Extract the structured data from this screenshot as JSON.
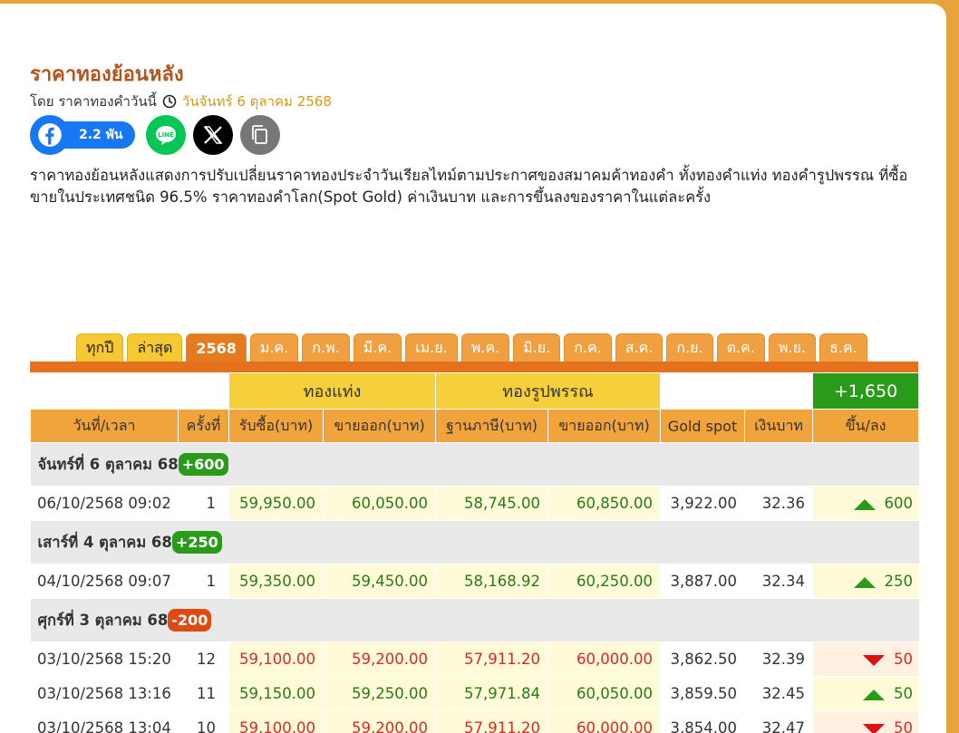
{
  "page": {
    "title": "ราคาทองย้อนหลัง",
    "byline_prefix": "โดย ราคาทองคำวันนี้",
    "date": "วันจันทร์ 6 ตุลาคม 2568",
    "description": "ราคาทองย้อนหลังแสดงการปรับเปลี่ยนราคาทองประจำวันเรียลไทม์ตามประกาศของสมาคมค้าทองคำ ทั้งทองคำแท่ง ทองคำรูปพรรณ ที่ซื้อขายในประเทศชนิด 96.5% ราคาทองคำโลก(Spot Gold) ค่าเงินบาท และการขึ้นลงของราคาในแต่ละครั้ง"
  },
  "share": {
    "facebook_count": "2.2 พัน",
    "colors": {
      "facebook": "#1877f2",
      "line": "#06c755",
      "x": "#000000",
      "copy": "#777777"
    }
  },
  "tabs": [
    {
      "label": "ทุกปี",
      "style": "yellow"
    },
    {
      "label": "ล่าสุด",
      "style": "yellow"
    },
    {
      "label": "2568",
      "style": "active"
    },
    {
      "label": "ม.ค."
    },
    {
      "label": "ก.พ."
    },
    {
      "label": "มี.ค."
    },
    {
      "label": "เม.ย."
    },
    {
      "label": "พ.ค."
    },
    {
      "label": "มิ.ย."
    },
    {
      "label": "ก.ค."
    },
    {
      "label": "ส.ค."
    },
    {
      "label": "ก.ย."
    },
    {
      "label": "ต.ค."
    },
    {
      "label": "พ.ย."
    },
    {
      "label": "ธ.ค."
    }
  ],
  "table": {
    "group_headers": {
      "bar": "ทองแท่ง",
      "ornament": "ทองรูปพรรณ",
      "total_change": "+1,650"
    },
    "columns": [
      "วันที่/เวลา",
      "ครั้งที่",
      "รับซื้อ(บาท)",
      "ขายออก(บาท)",
      "ฐานภาษี(บาท)",
      "ขายออก(บาท)",
      "Gold spot",
      "เงินบาท",
      "ขึ้น/ลง"
    ],
    "days": [
      {
        "label": "จันทร์ที่ 6 ตุลาคม 68",
        "badge": "+600",
        "dir": "up",
        "rows": [
          {
            "datetime": "06/10/2568 09:02",
            "no": "1",
            "bar_buy": "59,950.00",
            "bar_sell": "60,050.00",
            "orn_tax": "58,745.00",
            "orn_sell": "60,850.00",
            "spot": "3,922.00",
            "thb": "32.36",
            "dir": "up",
            "change": "600"
          }
        ]
      },
      {
        "label": "เสาร์ที่ 4 ตุลาคม 68",
        "badge": "+250",
        "dir": "up",
        "rows": [
          {
            "datetime": "04/10/2568 09:07",
            "no": "1",
            "bar_buy": "59,350.00",
            "bar_sell": "59,450.00",
            "orn_tax": "58,168.92",
            "orn_sell": "60,250.00",
            "spot": "3,887.00",
            "thb": "32.34",
            "dir": "up",
            "change": "250"
          }
        ]
      },
      {
        "label": "ศุกร์ที่ 3 ตุลาคม 68",
        "badge": "-200",
        "dir": "down",
        "rows": [
          {
            "datetime": "03/10/2568 15:20",
            "no": "12",
            "bar_buy": "59,100.00",
            "bar_sell": "59,200.00",
            "orn_tax": "57,911.20",
            "orn_sell": "60,000.00",
            "spot": "3,862.50",
            "thb": "32.39",
            "dir": "down",
            "change": "50"
          },
          {
            "datetime": "03/10/2568 13:16",
            "no": "11",
            "bar_buy": "59,150.00",
            "bar_sell": "59,250.00",
            "orn_tax": "57,971.84",
            "orn_sell": "60,050.00",
            "spot": "3,859.50",
            "thb": "32.45",
            "dir": "up",
            "change": "50"
          },
          {
            "datetime": "03/10/2568 13:04",
            "no": "10",
            "bar_buy": "59,100.00",
            "bar_sell": "59,200.00",
            "orn_tax": "57,911.20",
            "orn_sell": "60,000.00",
            "spot": "3,854.00",
            "thb": "32.47",
            "dir": "down",
            "change": "50"
          }
        ]
      }
    ]
  }
}
